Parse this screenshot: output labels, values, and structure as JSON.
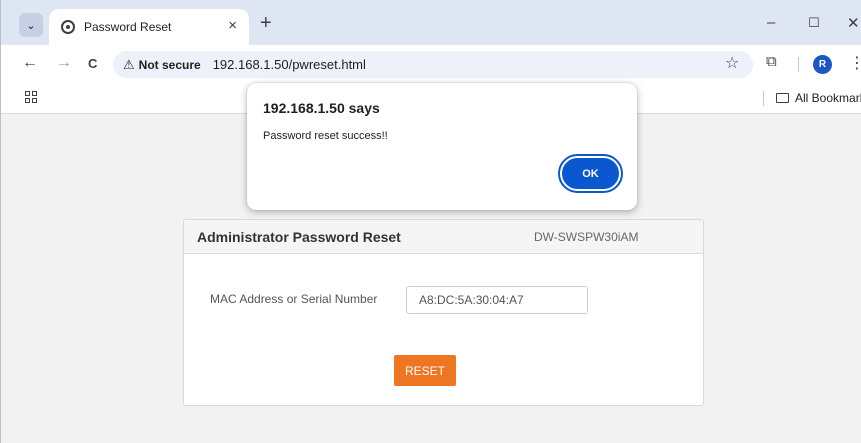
{
  "tab": {
    "title": "Password Reset",
    "close_glyph": "×",
    "new_tab_glyph": "+",
    "search_glyph": "⌄"
  },
  "window_controls": {
    "minimize": "–",
    "maximize": "☐",
    "close": "✕"
  },
  "toolbar": {
    "back_glyph": "←",
    "forward_glyph": "→",
    "reload_glyph": "C",
    "security_label": "Not secure",
    "security_icon": "⚠",
    "url": "192.168.1.50/pwreset.html",
    "star_glyph": "☆",
    "extensions_glyph": "⧉",
    "avatar_initial": "R",
    "menu_glyph": "⋮"
  },
  "bookmarks": {
    "all_bookmarks_label": "All Bookmarks"
  },
  "dialog": {
    "title": "192.168.1.50 says",
    "message": "Password reset success!!",
    "ok_label": "OK"
  },
  "panel": {
    "title": "Administrator Password Reset",
    "model": "DW-SWSPW30iAM",
    "field_label": "MAC Address or Serial Number",
    "field_value": "A8:DC:5A:30:04:A7",
    "reset_label": "RESET"
  },
  "colors": {
    "accent_blue": "#0b57d0",
    "reset_orange": "#ee7623",
    "tabstrip_bg": "#dfe6f3"
  }
}
